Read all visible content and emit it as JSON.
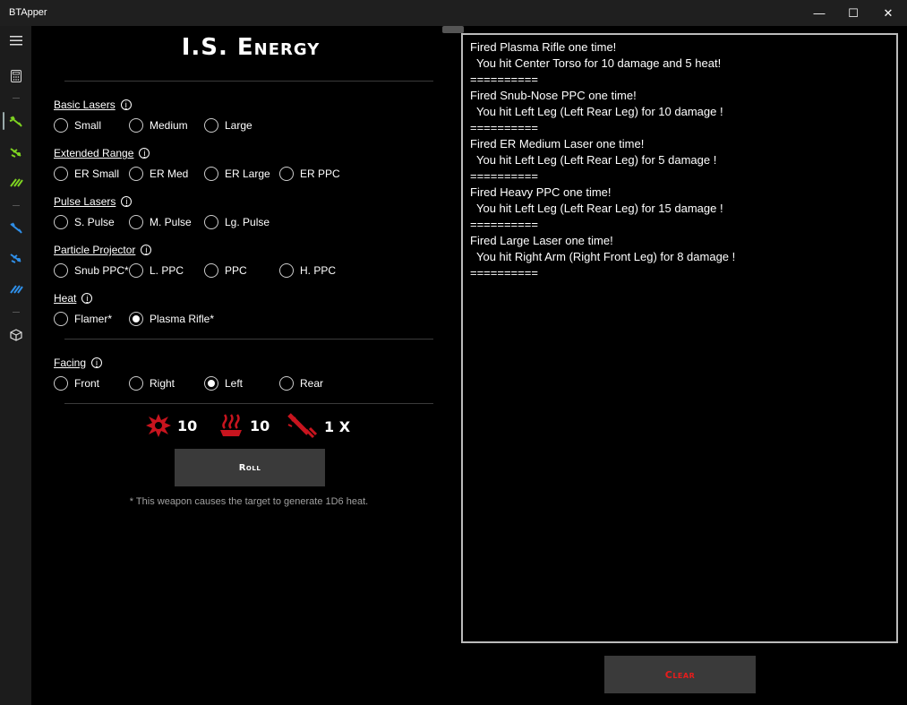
{
  "window": {
    "title": "BTApper",
    "minimize": "—",
    "maximize": "☐",
    "close": "✕"
  },
  "page": {
    "title": "I.S. Energy"
  },
  "groups": [
    {
      "label": "Basic Lasers",
      "options": [
        "Small",
        "Medium",
        "Large"
      ]
    },
    {
      "label": "Extended Range",
      "options": [
        "ER Small",
        "ER Med",
        "ER Large",
        "ER PPC"
      ]
    },
    {
      "label": "Pulse Lasers",
      "options": [
        "S. Pulse",
        "M. Pulse",
        "Lg. Pulse"
      ]
    },
    {
      "label": "Particle Projector",
      "options": [
        "Snub PPC*",
        "L. PPC",
        "PPC",
        "H. PPC"
      ]
    },
    {
      "label": "Heat",
      "options": [
        "Flamer*",
        "Plasma Rifle*"
      ],
      "selected": "Plasma Rifle*"
    }
  ],
  "facing": {
    "label": "Facing",
    "options": [
      "Front",
      "Right",
      "Left",
      "Rear"
    ],
    "selected": "Left"
  },
  "stats": {
    "damage": "10",
    "heat": "10",
    "shots": "1 X"
  },
  "roll_label": "Roll",
  "footnote": "* This weapon causes the target to generate 1D6 heat.",
  "log": [
    "Fired Plasma Rifle one time!",
    "  You hit Center Torso for 10 damage and 5 heat!",
    "==========",
    "Fired Snub-Nose PPC one time!",
    "  You hit Left Leg (Left Rear Leg) for 10 damage !",
    "==========",
    "Fired ER Medium Laser one time!",
    "  You hit Left Leg (Left Rear Leg) for 5 damage !",
    "==========",
    "Fired Heavy PPC one time!",
    "  You hit Left Leg (Left Rear Leg) for 15 damage !",
    "==========",
    "Fired Large Laser one time!",
    "  You hit Right Arm (Right Front Leg) for 8 damage !",
    "=========="
  ],
  "clear_label": "Clear",
  "colors": {
    "accent_green": "#7ed321",
    "accent_blue": "#2f8fe8",
    "accent_red": "#c8141e",
    "button_bg": "#3a3a3a"
  }
}
